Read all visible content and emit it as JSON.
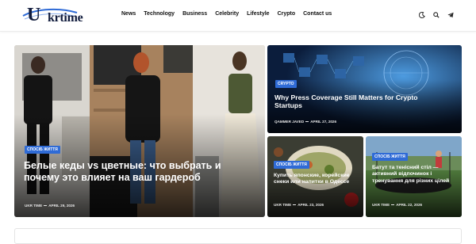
{
  "logo": {
    "letter": "U",
    "text": "krtime"
  },
  "nav": {
    "items": [
      {
        "label": "News"
      },
      {
        "label": "Technology"
      },
      {
        "label": "Business"
      },
      {
        "label": "Celebrity"
      },
      {
        "label": "Lifestyle"
      },
      {
        "label": "Crypto"
      },
      {
        "label": "Contact us"
      }
    ]
  },
  "header_icons": [
    "moon-icon",
    "search-icon",
    "telegram-icon"
  ],
  "featured": {
    "tag": "Спосіб життя",
    "title": "Белые кеды vs цветные: что выбрать и почему это влияет на ваш гардероб",
    "author": "UKR TIME",
    "date": "APRIL 29, 2026"
  },
  "top_right": {
    "tag": "Crypto",
    "title": "Why Press Coverage Still Matters for Crypto Startups",
    "author": "QAMMER JAVED",
    "date": "APRIL 27, 2026"
  },
  "bottom_left": {
    "tag": "Спосіб життя",
    "title": "Купить японские, корейские снеки или напитки в Одессе",
    "author": "UKR TIME",
    "date": "APRIL 23, 2026"
  },
  "bottom_right": {
    "tag": "Спосіб життя",
    "title": "Батут та тенісний стіл — активний відпочинок і тренування для різних цілей",
    "author": "UKR TIME",
    "date": "APRIL 22, 2026"
  },
  "colors": {
    "accent": "#2f6bd6",
    "brand": "#111c3d"
  }
}
